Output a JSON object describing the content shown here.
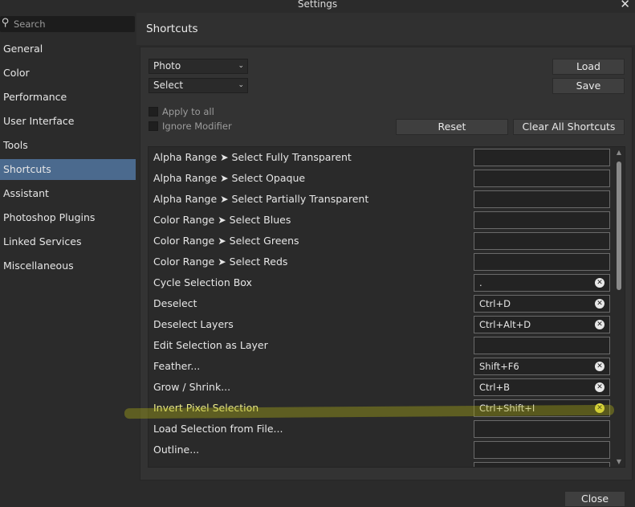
{
  "window": {
    "title": "Settings"
  },
  "search": {
    "placeholder": "Search"
  },
  "sidebar": {
    "items": [
      {
        "label": "General"
      },
      {
        "label": "Color"
      },
      {
        "label": "Performance"
      },
      {
        "label": "User Interface"
      },
      {
        "label": "Tools"
      },
      {
        "label": "Shortcuts",
        "active": true
      },
      {
        "label": "Assistant"
      },
      {
        "label": "Photoshop Plugins"
      },
      {
        "label": "Linked Services"
      },
      {
        "label": "Miscellaneous"
      }
    ]
  },
  "panel": {
    "title": "Shortcuts",
    "persona_select": "Photo",
    "category_select": "Select",
    "load_label": "Load",
    "save_label": "Save",
    "apply_to_all_label": "Apply to all",
    "ignore_modifier_label": "Ignore Modifier",
    "reset_label": "Reset",
    "clear_all_label": "Clear All Shortcuts"
  },
  "shortcuts": [
    {
      "label": "Alpha Range ➤ Select Fully Transparent",
      "key": ""
    },
    {
      "label": "Alpha Range ➤ Select Opaque",
      "key": ""
    },
    {
      "label": "Alpha Range ➤ Select Partially Transparent",
      "key": ""
    },
    {
      "label": "Color Range ➤ Select Blues",
      "key": ""
    },
    {
      "label": "Color Range ➤ Select Greens",
      "key": ""
    },
    {
      "label": "Color Range ➤ Select Reds",
      "key": ""
    },
    {
      "label": "Cycle Selection Box",
      "key": "."
    },
    {
      "label": "Deselect",
      "key": "Ctrl+D"
    },
    {
      "label": "Deselect Layers",
      "key": "Ctrl+Alt+D"
    },
    {
      "label": "Edit Selection as Layer",
      "key": ""
    },
    {
      "label": "Feather...",
      "key": "Shift+F6"
    },
    {
      "label": "Grow / Shrink...",
      "key": "Ctrl+B"
    },
    {
      "label": "Invert Pixel Selection",
      "key": "Ctrl+Shift+I",
      "highlighted": true
    },
    {
      "label": "Load Selection from File...",
      "key": ""
    },
    {
      "label": "Outline...",
      "key": ""
    }
  ],
  "footer": {
    "close_label": "Close"
  },
  "colors": {
    "accent": "#4b6a8e",
    "highlight": "#e6e04a"
  }
}
